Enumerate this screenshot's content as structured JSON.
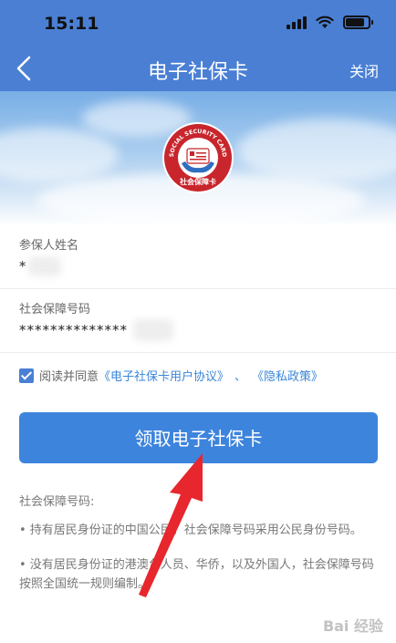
{
  "status_bar": {
    "time": "15:11"
  },
  "nav": {
    "title": "电子社保卡",
    "close_label": "关闭"
  },
  "logo": {
    "ring_text": "SOCIAL SECURITY CARD",
    "bottom_text": "社会保障卡"
  },
  "form": {
    "name_label": "参保人姓名",
    "name_value": "*",
    "id_label": "社会保障号码",
    "id_value": "**************"
  },
  "agreement": {
    "prefix": "阅读并同意",
    "user_agreement": "《电子社保卡用户协议》",
    "separator": "、",
    "privacy_policy": "《隐私政策》",
    "checked": true
  },
  "cta": {
    "label": "领取电子社保卡"
  },
  "info": {
    "title": "社会保障号码:",
    "items": [
      "• 持有居民身份证的中国公民，社会保障号码采用公民身份号码。",
      "• 没有居民身份证的港澳台人员、华侨，以及外国人，社会保障号码按照全国统一规则编制。"
    ]
  },
  "watermark": "Bai 经验",
  "colors": {
    "primary": "#4a7fd4",
    "button": "#3d84dd",
    "link": "#3a86d8",
    "annotation_arrow": "#e8262d"
  }
}
